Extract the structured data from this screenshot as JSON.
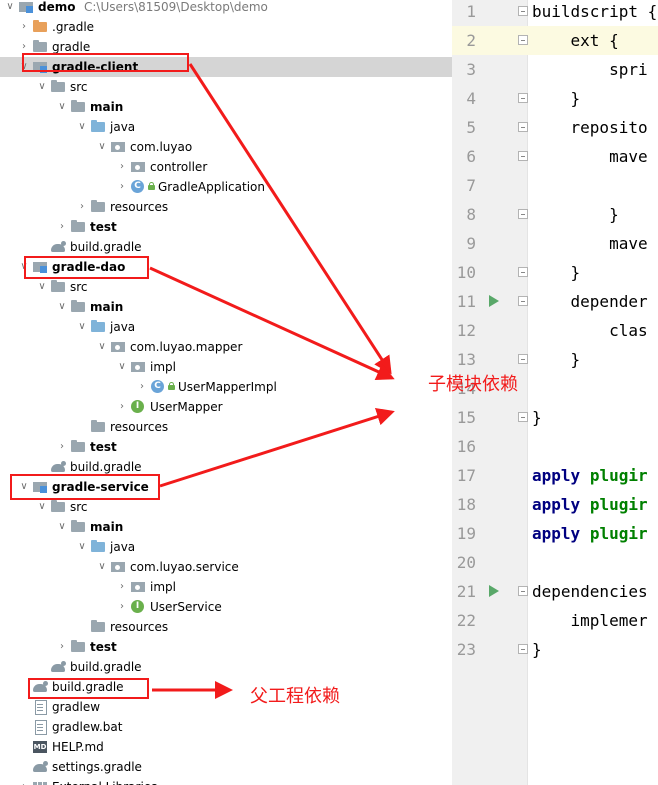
{
  "project_tree": {
    "rows": [
      {
        "label": "demo",
        "path": "C:\\Users\\81509\\Desktop\\demo",
        "icon": "module",
        "bold": true,
        "expanded": true
      },
      {
        "label": ".gradle",
        "icon": "folder-orange",
        "expanded": false
      },
      {
        "label": "gradle",
        "icon": "folder",
        "expanded": false
      },
      {
        "label": "gradle-client",
        "icon": "module",
        "bold": true,
        "expanded": true,
        "selected": true
      },
      {
        "label": "src",
        "icon": "folder",
        "expanded": true
      },
      {
        "label": "main",
        "icon": "folder",
        "bold": true,
        "expanded": true
      },
      {
        "label": "java",
        "icon": "folder-blue",
        "expanded": true
      },
      {
        "label": "com.luyao",
        "icon": "package",
        "expanded": true
      },
      {
        "label": "controller",
        "icon": "package",
        "expanded": false
      },
      {
        "label": "GradleApplication",
        "icon": "class",
        "expanded": false
      },
      {
        "label": "resources",
        "icon": "folder",
        "expanded": false
      },
      {
        "label": "test",
        "icon": "folder",
        "bold": true,
        "expanded": false
      },
      {
        "label": "build.gradle",
        "icon": "gradle"
      },
      {
        "label": "gradle-dao",
        "icon": "module",
        "bold": true,
        "expanded": true
      },
      {
        "label": "src",
        "icon": "folder",
        "expanded": true
      },
      {
        "label": "main",
        "icon": "folder",
        "bold": true,
        "expanded": true
      },
      {
        "label": "java",
        "icon": "folder-blue",
        "expanded": true
      },
      {
        "label": "com.luyao.mapper",
        "icon": "package",
        "expanded": true
      },
      {
        "label": "impl",
        "icon": "package",
        "expanded": true
      },
      {
        "label": "UserMapperImpl",
        "icon": "class",
        "expanded": false
      },
      {
        "label": "UserMapper",
        "icon": "interface",
        "expanded": false
      },
      {
        "label": "resources",
        "icon": "folder"
      },
      {
        "label": "test",
        "icon": "folder",
        "bold": true,
        "expanded": false
      },
      {
        "label": "build.gradle",
        "icon": "gradle"
      },
      {
        "label": "gradle-service",
        "icon": "module",
        "bold": true,
        "expanded": true
      },
      {
        "label": "src",
        "icon": "folder",
        "expanded": true
      },
      {
        "label": "main",
        "icon": "folder",
        "bold": true,
        "expanded": true
      },
      {
        "label": "java",
        "icon": "folder-blue",
        "expanded": true
      },
      {
        "label": "com.luyao.service",
        "icon": "package",
        "expanded": true
      },
      {
        "label": "impl",
        "icon": "package",
        "expanded": false
      },
      {
        "label": "UserService",
        "icon": "interface",
        "expanded": false
      },
      {
        "label": "resources",
        "icon": "folder"
      },
      {
        "label": "test",
        "icon": "folder",
        "bold": true,
        "expanded": false
      },
      {
        "label": "build.gradle",
        "icon": "gradle"
      },
      {
        "label": "build.gradle",
        "icon": "gradle"
      },
      {
        "label": "gradlew",
        "icon": "file"
      },
      {
        "label": "gradlew.bat",
        "icon": "file"
      },
      {
        "label": "HELP.md",
        "icon": "md"
      },
      {
        "label": "settings.gradle",
        "icon": "gradle"
      },
      {
        "label": "External Libraries",
        "icon": "library",
        "expanded": false
      }
    ]
  },
  "editor": {
    "lines": [
      {
        "n": "1",
        "code": "buildscript {"
      },
      {
        "n": "2",
        "code": "    ext {"
      },
      {
        "n": "3",
        "code": "        spri"
      },
      {
        "n": "4",
        "code": "    }"
      },
      {
        "n": "5",
        "code": "    reposito"
      },
      {
        "n": "6",
        "code": "        mave"
      },
      {
        "n": "7",
        "code": ""
      },
      {
        "n": "8",
        "code": "        }"
      },
      {
        "n": "9",
        "code": "        mave"
      },
      {
        "n": "10",
        "code": "    }"
      },
      {
        "n": "11",
        "code": "    depender"
      },
      {
        "n": "12",
        "code": "        clas"
      },
      {
        "n": "13",
        "code": "    }"
      },
      {
        "n": "14",
        "code": ""
      },
      {
        "n": "15",
        "code": "}"
      },
      {
        "n": "16",
        "code": ""
      },
      {
        "n": "17",
        "code": "apply plugir",
        "kw": "apply",
        "grn": "plugir"
      },
      {
        "n": "18",
        "code": "apply plugir",
        "kw": "apply",
        "grn": "plugir"
      },
      {
        "n": "19",
        "code": "apply plugir",
        "kw": "apply",
        "grn": "plugir"
      },
      {
        "n": "20",
        "code": ""
      },
      {
        "n": "21",
        "code": "dependencies"
      },
      {
        "n": "22",
        "code": "    implemer"
      },
      {
        "n": "23",
        "code": "}"
      }
    ]
  },
  "annotations": {
    "submodule_label": "子模块依赖",
    "parent_label": "父工程依赖",
    "color": "#f21b1b"
  }
}
